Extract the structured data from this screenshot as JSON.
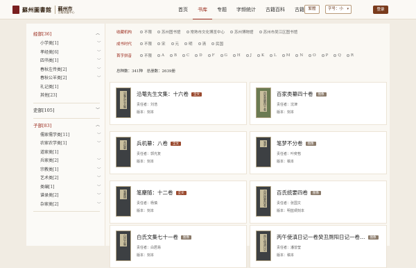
{
  "header": {
    "logo_1": "蘇州圖書館",
    "logo_2": "蘇州市",
    "logo_2_sub": "古籍保護中心",
    "nav": [
      "首页",
      "书库",
      "专题",
      "字频统计",
      "古籍百科",
      "古籍活化"
    ],
    "active_nav": "书库",
    "trad_label": "繁體",
    "font_size_label": "字号：小",
    "login_label": "登录"
  },
  "sidebar": {
    "categories": [
      {
        "label": "经部[36]",
        "expanded": true,
        "subs": [
          {
            "label": "小学类[1]",
            "caret": true
          },
          {
            "label": "孝经类[6]",
            "caret": true
          },
          {
            "label": "四书类[1]",
            "caret": true
          },
          {
            "label": "春秋左传类[2]",
            "caret": true
          },
          {
            "label": "春秋公羊类[2]",
            "caret": true
          },
          {
            "label": "礼记类[1]",
            "caret": false
          },
          {
            "label": "其他[23]",
            "caret": false
          }
        ]
      },
      {
        "label": "史部[105]",
        "expanded": false,
        "subs": []
      },
      {
        "label": "子部[83]",
        "expanded": true,
        "subs": [
          {
            "label": "儒家儒学类[11]",
            "caret": true
          },
          {
            "label": "农家农学类[1]",
            "caret": true
          },
          {
            "label": "道家类[1]",
            "caret": false
          },
          {
            "label": "兵家类[2]",
            "caret": true
          },
          {
            "label": "宗教类[1]",
            "caret": true
          },
          {
            "label": "艺术类[2]",
            "caret": true
          },
          {
            "label": "类编[1]",
            "caret": true
          },
          {
            "label": "谱录类[2]",
            "caret": true
          },
          {
            "label": "杂家类[2]",
            "caret": true
          }
        ]
      }
    ]
  },
  "filters": {
    "institution": {
      "label": "收藏机构",
      "options": [
        "不限",
        "苏州图书馆",
        "常熟市文化博览中心",
        "苏州博物馆",
        "苏州市吴江区图书馆"
      ]
    },
    "dynasty": {
      "label": "成书时代",
      "options": [
        "不限",
        "宋",
        "元",
        "明",
        "清",
        "民国"
      ]
    },
    "pinyin": {
      "label": "首字拼音",
      "options": [
        "不限",
        "A",
        "B",
        "C",
        "D",
        "F",
        "G",
        "H",
        "J",
        "K",
        "L",
        "M",
        "N",
        "O",
        "P",
        "Q",
        "R"
      ]
    }
  },
  "totals": "总种数：341种　总册数：2639册",
  "books": [
    {
      "title": "沿菴先生文集：十六卷",
      "tag": "全文",
      "tag_style": "red",
      "author": "责任者：刘浩",
      "edition": "版本：刻本",
      "cover_label": "沿菴先生文集"
    },
    {
      "title": "百家类纂四十卷",
      "tag": "图像",
      "tag_style": "green",
      "author": "责任者：沈津",
      "edition": "版本：刻本",
      "cover_label": "百家类纂四十卷"
    },
    {
      "title": "兵机纂：八卷",
      "tag": "全文",
      "tag_style": "red",
      "author": "责任者：郭光复",
      "edition": "版本：刻本",
      "cover_label": "兵机纂"
    },
    {
      "title": "笔梦不分卷",
      "tag": "图像",
      "tag_style": "green",
      "author": "责任者：叶奕苞",
      "edition": "版本：稿本",
      "cover_label": "笔梦"
    },
    {
      "title": "笔麈随：十二卷",
      "tag": "全文",
      "tag_style": "red",
      "author": "责任者：杨慎",
      "edition": "版本：刻本",
      "cover_label": "笔麈随"
    },
    {
      "title": "百氏统要四卷",
      "tag": "图像",
      "tag_style": "green",
      "author": "责任者：张国文",
      "edition": "版本：明蓝绸刻本",
      "cover_label": "百氏统要四卷"
    },
    {
      "title": "白氏文集七十一卷",
      "tag": "图像",
      "tag_style": "green",
      "author": "责任者：白居易",
      "edition": "版本：刻本",
      "cover_label": "白氏文集"
    },
    {
      "title": "丙午使滇日记一卷癸丑厕阳日记一卷…",
      "tag": "图像",
      "tag_style": "green",
      "author": "责任者：潘曾莹",
      "edition": "版本：稿本",
      "cover_label": "丙午使滇日记"
    }
  ]
}
